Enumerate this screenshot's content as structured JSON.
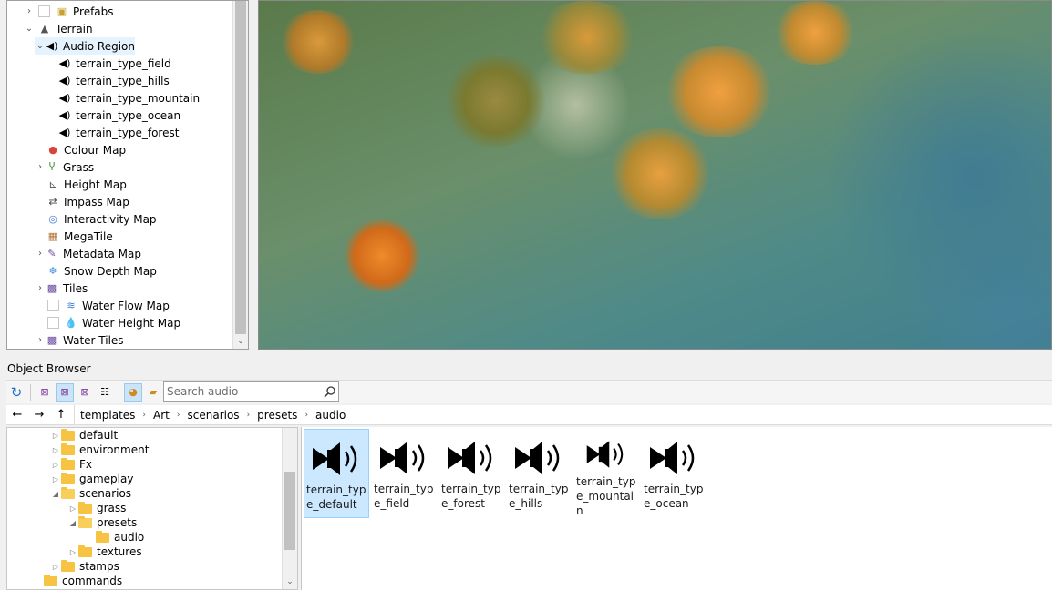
{
  "scene_tree": {
    "items": [
      {
        "label": "Prefabs",
        "icon": "prefab-icon"
      },
      {
        "label": "Terrain",
        "icon": "terrain-icon"
      },
      {
        "label": "Audio Region",
        "icon": "speaker-icon"
      },
      {
        "label": "terrain_type_field",
        "icon": "speaker-icon"
      },
      {
        "label": "terrain_type_hills",
        "icon": "speaker-icon"
      },
      {
        "label": "terrain_type_mountain",
        "icon": "speaker-icon"
      },
      {
        "label": "terrain_type_ocean",
        "icon": "speaker-icon"
      },
      {
        "label": "terrain_type_forest",
        "icon": "speaker-icon"
      },
      {
        "label": "Colour Map",
        "icon": "colour-map-icon"
      },
      {
        "label": "Grass",
        "icon": "grass-icon"
      },
      {
        "label": "Height Map",
        "icon": "height-map-icon"
      },
      {
        "label": "Impass Map",
        "icon": "impass-map-icon"
      },
      {
        "label": "Interactivity Map",
        "icon": "interactivity-map-icon"
      },
      {
        "label": "MegaTile",
        "icon": "megatile-icon"
      },
      {
        "label": "Metadata Map",
        "icon": "metadata-map-icon"
      },
      {
        "label": "Snow Depth Map",
        "icon": "snow-icon"
      },
      {
        "label": "Tiles",
        "icon": "tiles-icon"
      },
      {
        "label": "Water Flow Map",
        "icon": "water-flow-icon"
      },
      {
        "label": "Water Height Map",
        "icon": "water-drop-icon"
      },
      {
        "label": "Water Tiles",
        "icon": "water-tiles-icon"
      }
    ]
  },
  "object_browser": {
    "title": "Object Browser",
    "search_placeholder": "Search audio",
    "breadcrumb": [
      "templates",
      "Art",
      "scenarios",
      "presets",
      "audio"
    ],
    "folders": [
      {
        "label": "default"
      },
      {
        "label": "environment"
      },
      {
        "label": "Fx"
      },
      {
        "label": "gameplay"
      },
      {
        "label": "scenarios"
      },
      {
        "label": "grass"
      },
      {
        "label": "presets"
      },
      {
        "label": "audio"
      },
      {
        "label": "textures"
      },
      {
        "label": "stamps"
      },
      {
        "label": "commands"
      }
    ],
    "assets": [
      {
        "label": "terrain_type_default",
        "selected": true
      },
      {
        "label": "terrain_type_field"
      },
      {
        "label": "terrain_type_forest"
      },
      {
        "label": "terrain_type_hills"
      },
      {
        "label": "terrain_type_mountain"
      },
      {
        "label": "terrain_type_ocean"
      }
    ]
  },
  "colors": {
    "selection": "#cce8ff",
    "folder": "#f6c343",
    "accent": "#0078d7"
  }
}
